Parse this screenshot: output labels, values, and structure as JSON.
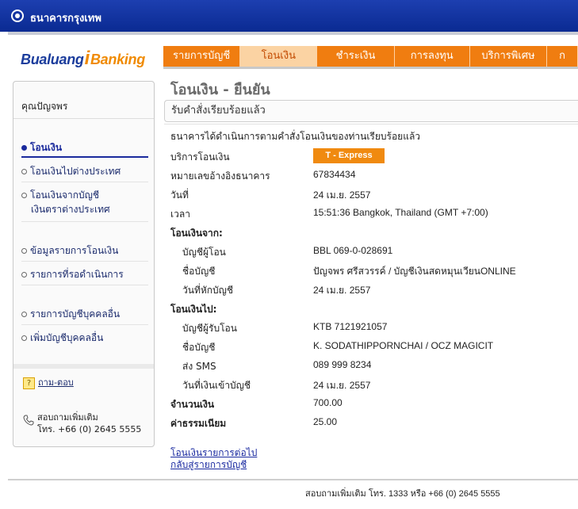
{
  "header": {
    "bank_name": "ธนาคารกรุงเทพ",
    "brand_left": "Bualuang",
    "brand_i": "i",
    "brand_right": "Banking"
  },
  "nav": {
    "tabs": [
      {
        "label": "รายการบัญชี"
      },
      {
        "label": "โอนเงิน"
      },
      {
        "label": "ชำระเงิน"
      },
      {
        "label": "การลงทุน"
      },
      {
        "label": "บริการพิเศษ"
      },
      {
        "label": "ก"
      }
    ]
  },
  "sidebar": {
    "user": "คุณปัญจพร",
    "items": [
      {
        "label": "โอนเงิน"
      },
      {
        "label": "โอนเงินไปต่างประเทศ"
      },
      {
        "label": "โอนเงินจากบัญชี"
      },
      {
        "label": "เงินตราต่างประเทศ"
      },
      {
        "label": "ข้อมูลรายการโอนเงิน"
      },
      {
        "label": "รายการที่รอดำเนินการ"
      },
      {
        "label": "รายการบัญชีบุคคลอื่น"
      },
      {
        "label": "เพิ่มบัญชีบุคคลอื่น"
      }
    ],
    "faq": "ถาม-ตอบ",
    "contact_line1": "สอบถามเพิ่มเติม",
    "contact_line2": "โทร. +66 (0) 2645 5555"
  },
  "main": {
    "title": "โอนเงิน - ยืนยัน",
    "subhead": "รับคำสั่งเรียบร้อยแล้ว",
    "confirm_msg": "ธนาคารได้ดำเนินการตามคำสั่งโอนเงินของท่านเรียบร้อยแล้ว",
    "service_label": "บริการโอนเงิน",
    "service_value": "T - Express",
    "ref_label": "หมายเลขอ้างอิงธนาคาร",
    "ref_value": "67834434",
    "date_label": "วันที่",
    "date_value": "24 เม.ย. 2557",
    "time_label": "เวลา",
    "time_value": "15:51:36 Bangkok, Thailand (GMT +7:00)",
    "from_heading": "โอนเงินจาก:",
    "from_account_label": "บัญชีผู้โอน",
    "from_account_value": "BBL 069-0-028691",
    "from_name_label": "ชื่อบัญชี",
    "from_name_value": "ปัญจพร ศรีสวรรค์ / บัญชีเงินสดหมุนเวียนONLINE",
    "debit_date_label": "วันที่หักบัญชี",
    "debit_date_value": "24 เม.ย. 2557",
    "to_heading": "โอนเงินไป:",
    "to_account_label": "บัญชีผู้รับโอน",
    "to_account_value": "KTB 7121921057",
    "to_name_label": "ชื่อบัญชี",
    "to_name_value": "K. SODATHIPPORNCHAI / OCZ MAGICIT",
    "sms_label": "ส่ง SMS",
    "sms_value": "089 999 8234",
    "credit_date_label": "วันที่เงินเข้าบัญชี",
    "credit_date_value": "24 เม.ย. 2557",
    "amount_label": "จำนวนเงิน",
    "amount_value": "700.00",
    "fee_label": "ค่าธรรมเนียม",
    "fee_value": "25.00",
    "link_next": "โอนเงินรายการต่อไป",
    "link_back": "กลับสู่รายการบัญชี"
  },
  "footer": {
    "text": "สอบถามเพิ่มเติม โทร. 1333 หรือ +66 (0) 2645 5555"
  },
  "colors": {
    "header_blue": "#0a2a92",
    "nav_orange": "#f07d10",
    "link_blue": "#1a2aa0"
  }
}
